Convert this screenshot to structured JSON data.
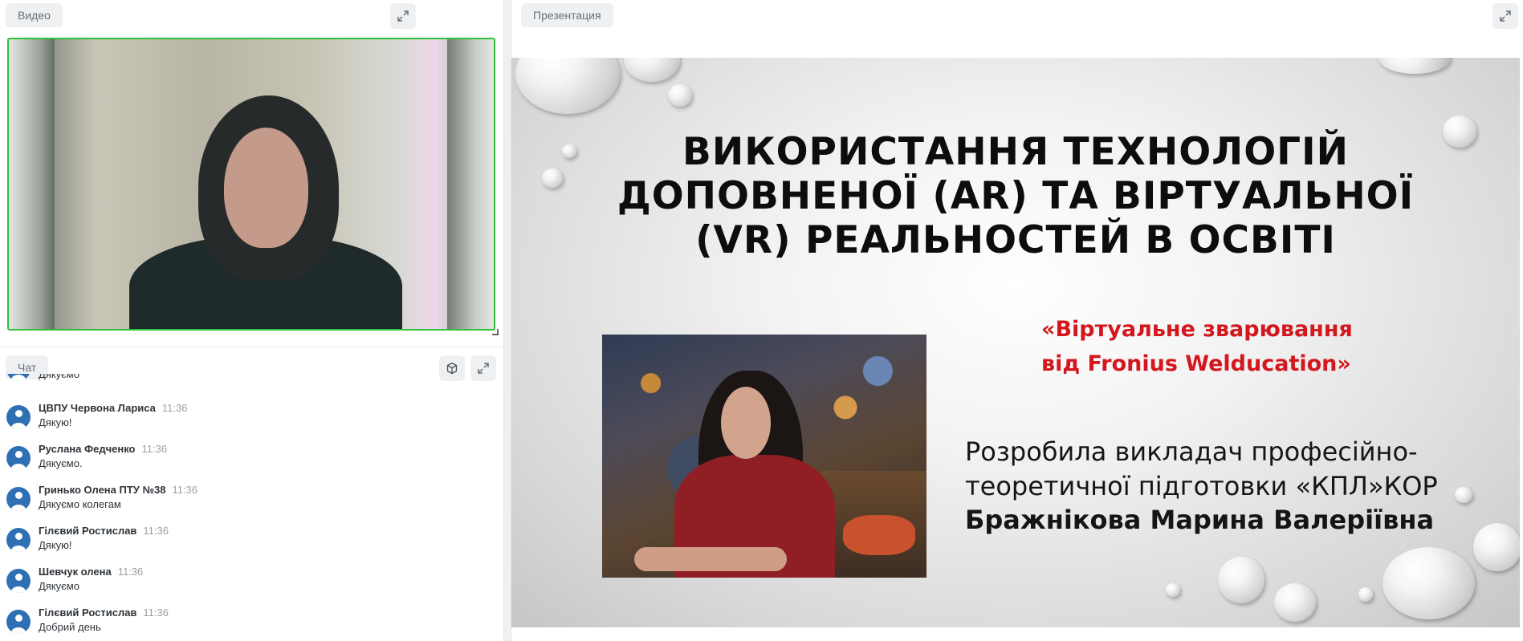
{
  "video_panel": {
    "title": "Видео"
  },
  "chat_panel": {
    "title": "Чат",
    "partial_top_text": "Дякуємо",
    "messages": [
      {
        "name": "ЦВПУ Червона Лариса",
        "time": "11:36",
        "text": "Дякую!"
      },
      {
        "name": "Руслана Федченко",
        "time": "11:36",
        "text": "Дякуємо."
      },
      {
        "name": "Гринько Олена ПТУ №38",
        "time": "11:36",
        "text": "Дякуємо колегам"
      },
      {
        "name": "Гілєвий Ростислав",
        "time": "11:36",
        "text": "Дякую!"
      },
      {
        "name": "Шевчук олена",
        "time": "11:36",
        "text": "Дякуємо"
      },
      {
        "name": "Гілєвий Ростислав",
        "time": "11:36",
        "text": "Добрий день"
      }
    ]
  },
  "presentation_panel": {
    "title": "Презентация",
    "slide": {
      "title_line1": "ВИКОРИСТАННЯ ТЕХНОЛОГІЙ",
      "title_line2": "ДОПОВНЕНОЇ  (AR) ТА  ВІРТУАЛЬНОЇ",
      "title_line3": "(VR) РЕАЛЬНОСТЕЙ В ОСВІТІ",
      "subtitle_line1": "«Віртуальне зварювання",
      "subtitle_line2": "від Fronius Welducation»",
      "author_line1": "Розробила викладач професійно-",
      "author_line2": "теоретичної підготовки  «КПЛ»КОР",
      "author_name": "Бражнікова Марина Валеріївна"
    }
  },
  "icons": {
    "expand": "expand-icon",
    "cube": "cube-icon",
    "avatar": "user-avatar-icon"
  },
  "colors": {
    "active_speaker_border": "#2fbf3a",
    "avatar_bg": "#2f6fb4",
    "subtitle_red": "#d3171c"
  }
}
